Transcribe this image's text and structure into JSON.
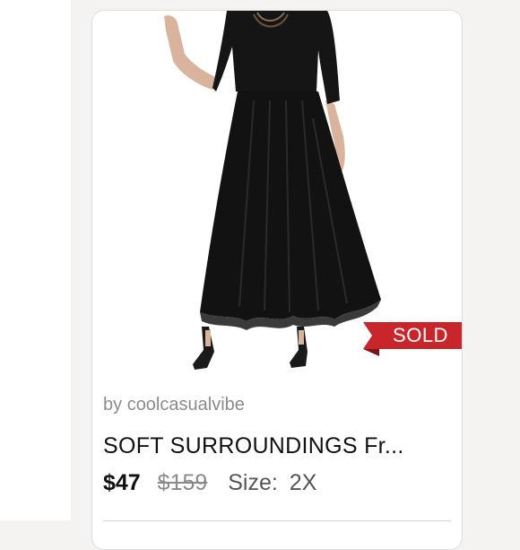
{
  "listing": {
    "seller_prefix": "by",
    "seller_name": "coolcasualvibe",
    "title": "SOFT SURROUNDINGS Fr...",
    "price": "$47",
    "original_price": "$159",
    "size_label": "Size:",
    "size_value": "2X",
    "badge": "SOLD",
    "image_icon": "product-photo-black-maxi-dress"
  },
  "colors": {
    "sold_badge": "#c8262b",
    "dress": "#121212",
    "background": "#f4f3f1"
  }
}
